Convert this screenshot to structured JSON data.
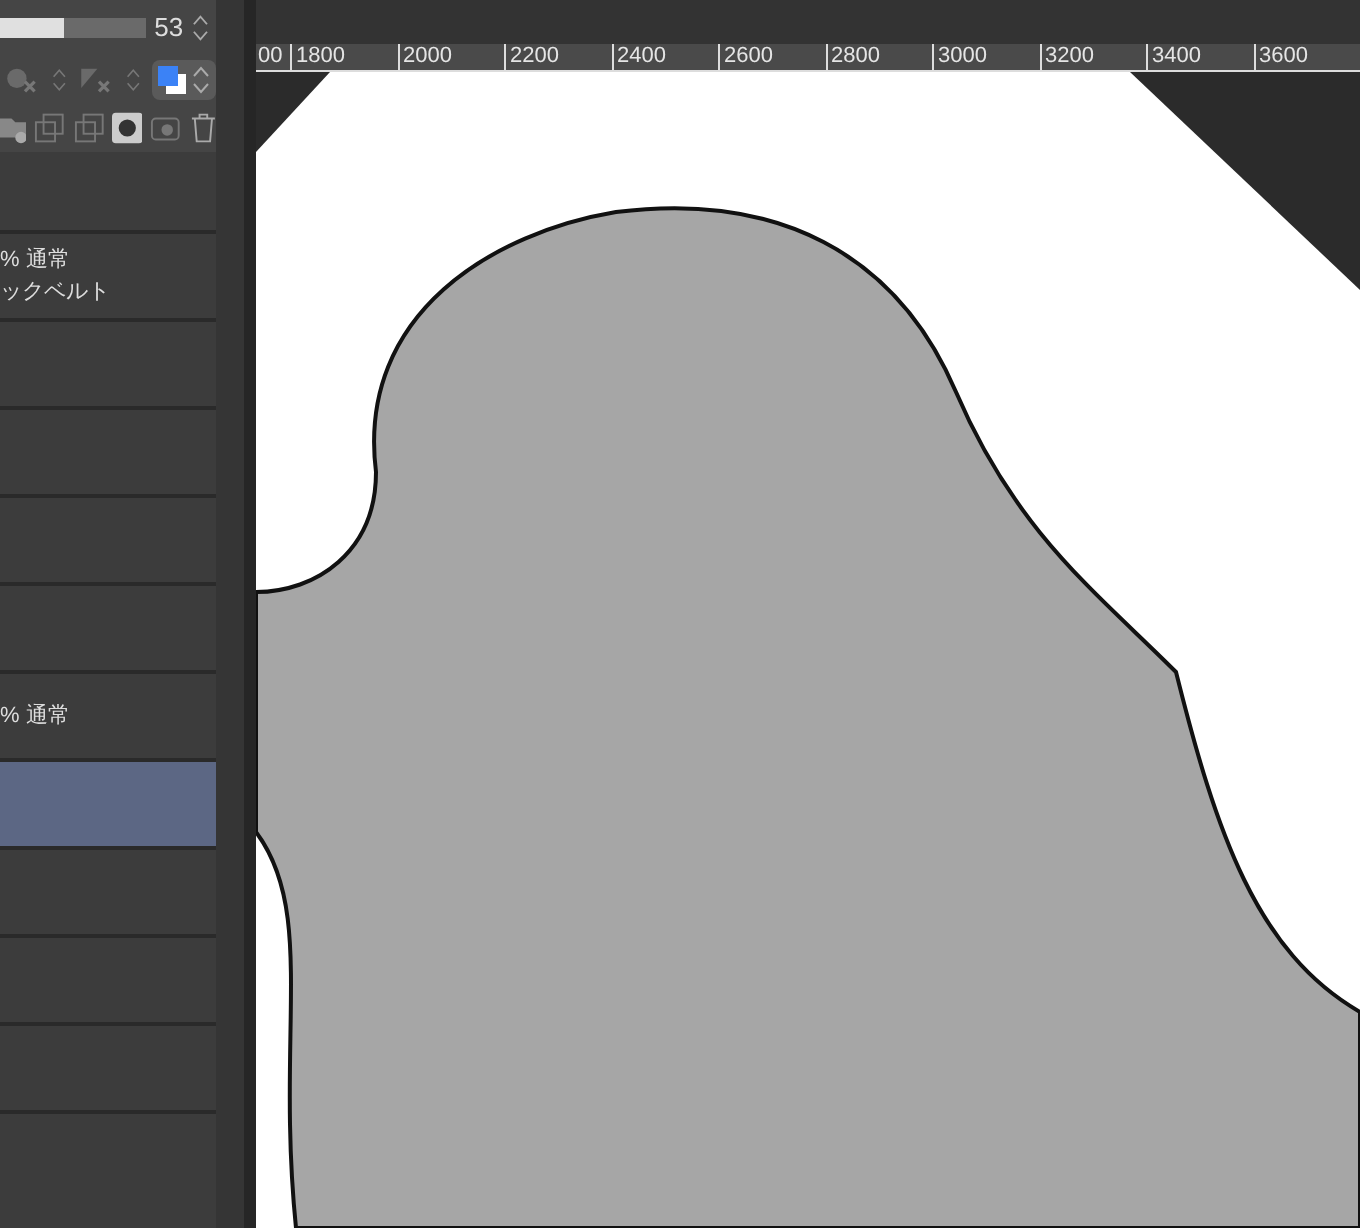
{
  "opacity_slider": {
    "level": 0.44,
    "value": "53"
  },
  "ruler": {
    "labels": [
      "00",
      "1800",
      "2000",
      "2200",
      "2400",
      "2600",
      "2800",
      "3000",
      "3200",
      "3400",
      "3600"
    ]
  },
  "layers": [
    {
      "mode": "% 通常",
      "name": "ックベルト",
      "selected": false
    },
    {
      "selected": false
    },
    {
      "selected": false
    },
    {
      "selected": false
    },
    {
      "selected": false
    },
    {
      "mode": "% 通常",
      "selected": false
    },
    {
      "selected": true
    },
    {
      "selected": false
    },
    {
      "selected": false
    },
    {
      "selected": false
    },
    {
      "selected": false
    }
  ]
}
